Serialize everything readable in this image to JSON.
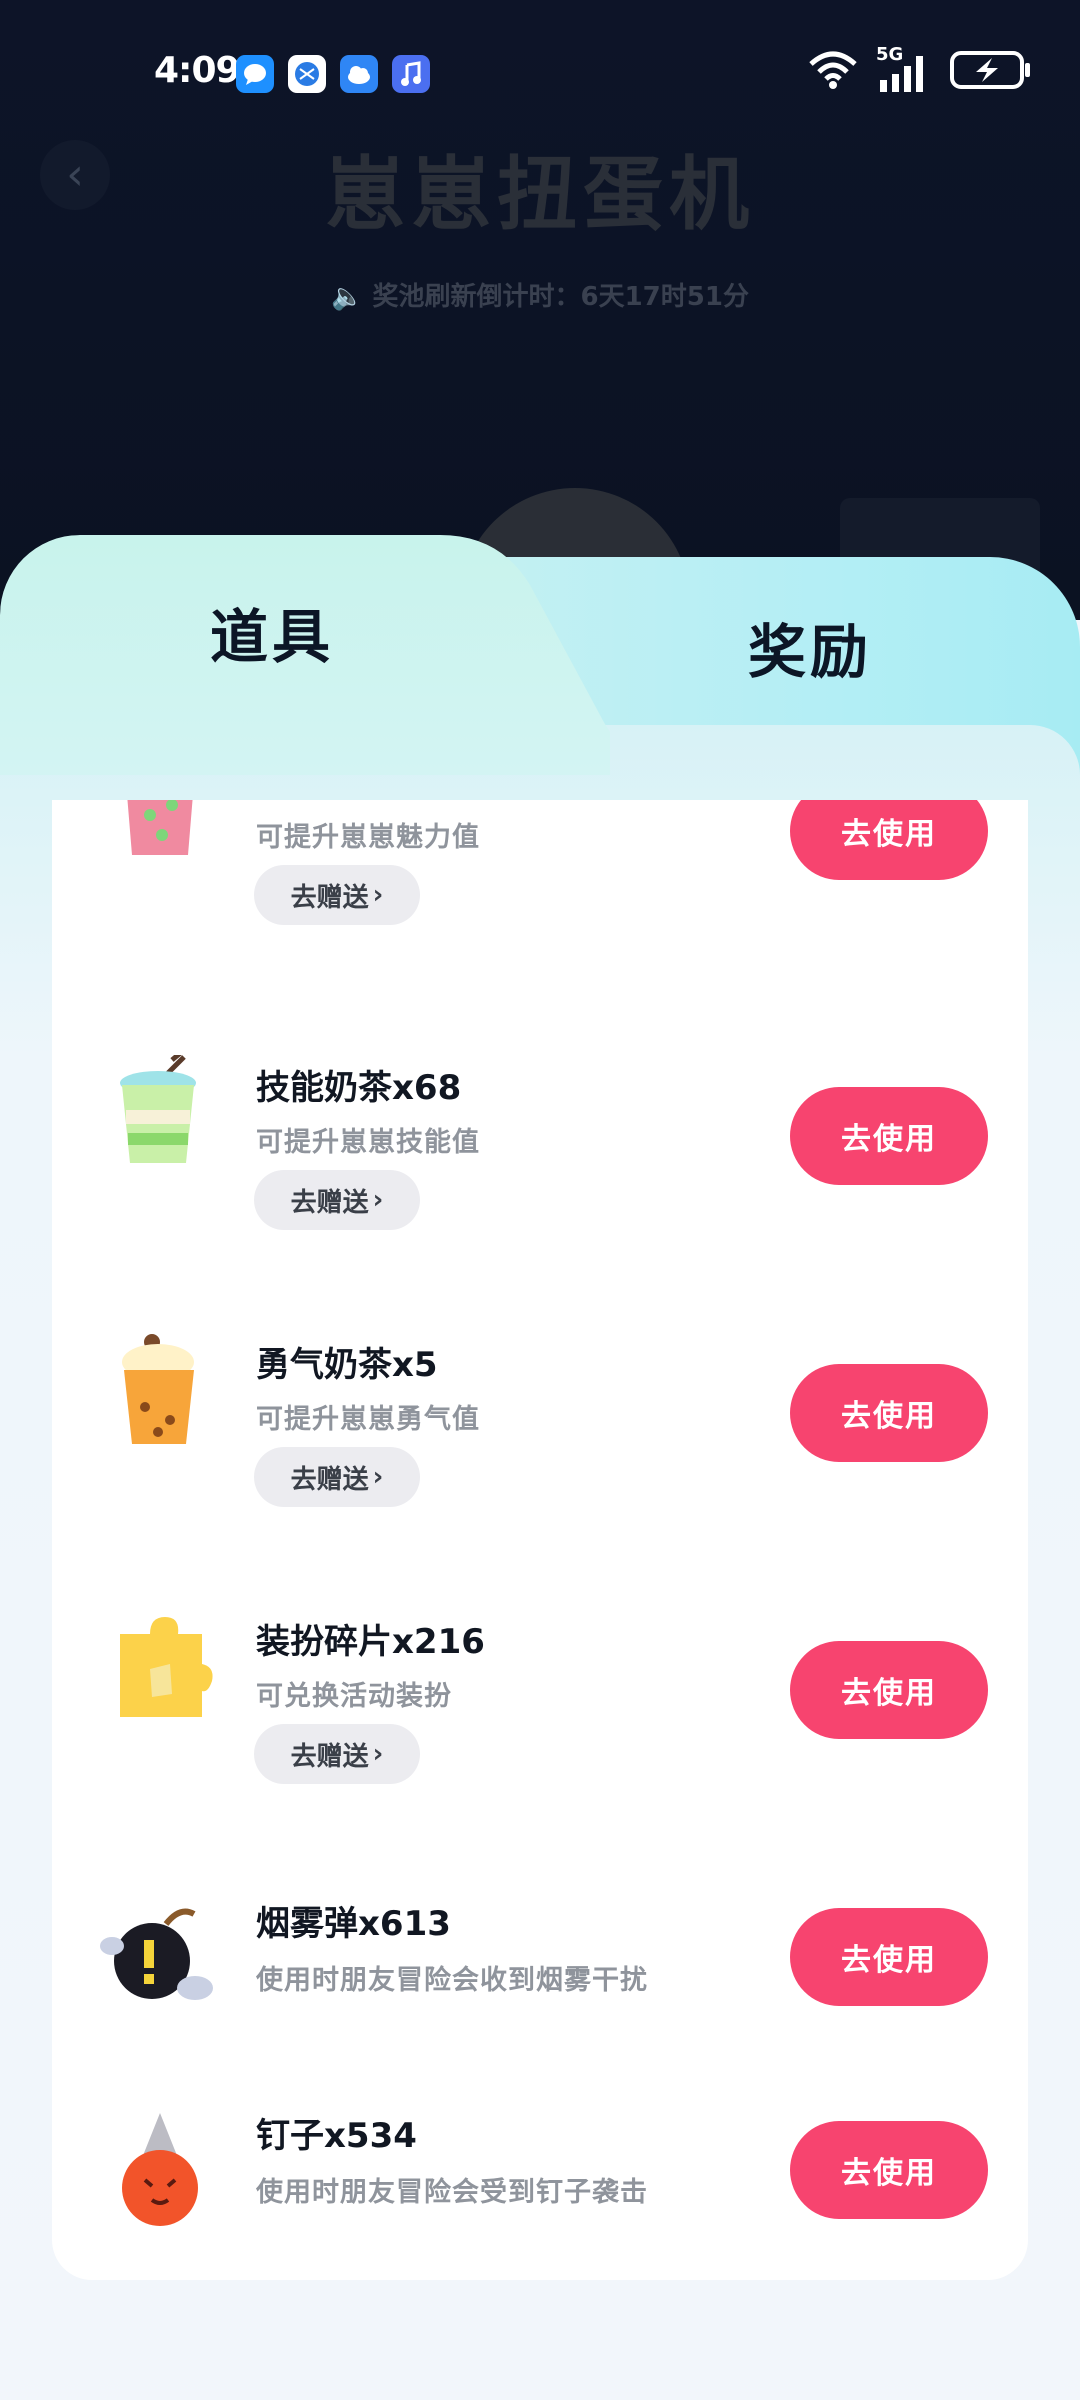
{
  "status_bar": {
    "time": "4:09",
    "network": "5G"
  },
  "background": {
    "title": "崽崽扭蛋机",
    "countdown": "奖池刷新倒计时：6天17时51分"
  },
  "tabs": [
    {
      "label": "道具"
    },
    {
      "label": "奖励"
    }
  ],
  "items": [
    {
      "name": "",
      "desc": "可提升崽崽魅力值",
      "gift_label": "去赠送",
      "use_label": "去使用",
      "icon": "strawberry-tea-icon"
    },
    {
      "name": "技能奶茶x68",
      "desc": "可提升崽崽技能值",
      "gift_label": "去赠送",
      "use_label": "去使用",
      "icon": "skill-milk-tea-icon"
    },
    {
      "name": "勇气奶茶x5",
      "desc": "可提升崽崽勇气值",
      "gift_label": "去赠送",
      "use_label": "去使用",
      "icon": "courage-milk-tea-icon"
    },
    {
      "name": "装扮碎片x216",
      "desc": "可兑换活动装扮",
      "gift_label": "去赠送",
      "use_label": "去使用",
      "icon": "puzzle-piece-icon"
    },
    {
      "name": "烟雾弹x613",
      "desc": "使用时朋友冒险会收到烟雾干扰",
      "use_label": "去使用",
      "icon": "smoke-bomb-icon"
    },
    {
      "name": "钉子x534",
      "desc": "使用时朋友冒险会受到钉子袭击",
      "use_label": "去使用",
      "icon": "nail-icon"
    }
  ]
}
